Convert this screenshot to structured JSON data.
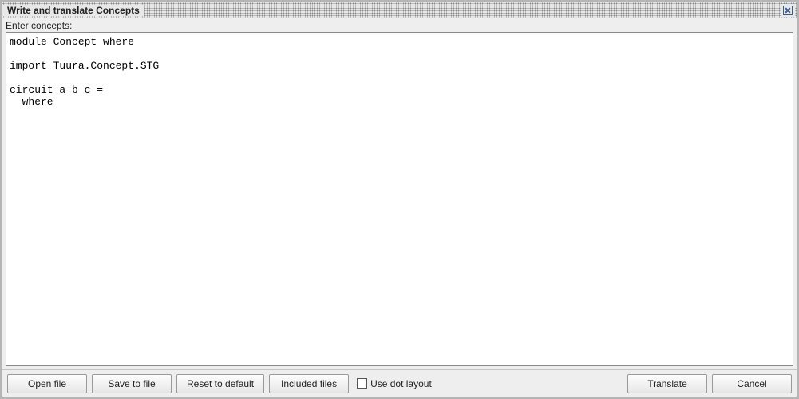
{
  "titlebar": {
    "title": "Write and translate Concepts"
  },
  "prompt": "Enter concepts:",
  "editor": {
    "content": "module Concept where\n\nimport Tuura.Concept.STG\n\ncircuit a b c = \n  where"
  },
  "buttons": {
    "open_file": "Open file",
    "save_to_file": "Save to file",
    "reset_to_default": "Reset to default",
    "included_files": "Included files",
    "translate": "Translate",
    "cancel": "Cancel"
  },
  "checkbox": {
    "use_dot_layout_label": "Use dot layout",
    "use_dot_layout_checked": false
  }
}
